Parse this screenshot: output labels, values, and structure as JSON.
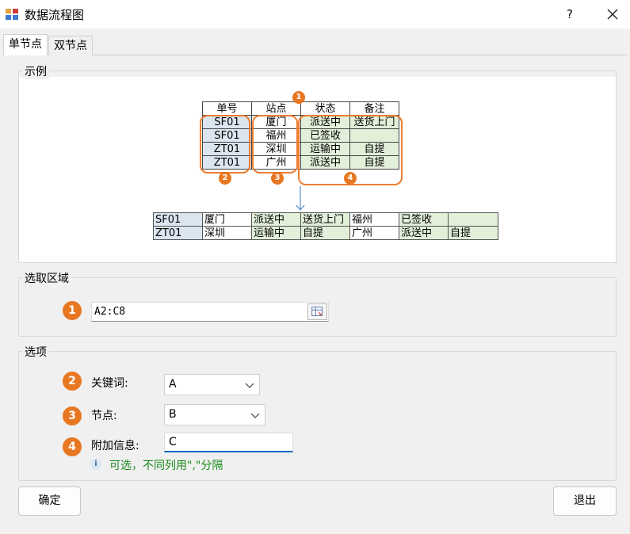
{
  "window": {
    "title": "数据流程图",
    "help_label": "?"
  },
  "tabs": [
    {
      "label": "单节点"
    },
    {
      "label": "双节点"
    }
  ],
  "example": {
    "title": "示例",
    "headers": [
      "单号",
      "站点",
      "状态",
      "备注"
    ],
    "rows": [
      [
        "SF01",
        "厦门",
        "派送中",
        "送货上门"
      ],
      [
        "SF01",
        "福州",
        "已签收",
        ""
      ],
      [
        "ZT01",
        "深圳",
        "运输中",
        "自提"
      ],
      [
        "ZT01",
        "广州",
        "派送中",
        "自提"
      ]
    ],
    "badges": [
      "1",
      "2",
      "3",
      "4"
    ],
    "result_rows": [
      [
        "SF01",
        "厦门",
        "派送中",
        "送货上门",
        "福州",
        "已签收",
        ""
      ],
      [
        "ZT01",
        "深圳",
        "运输中",
        "自提",
        "广州",
        "派送中",
        "自提"
      ]
    ]
  },
  "range_group": {
    "title": "选取区域",
    "badge": "1",
    "value": "A2:C8"
  },
  "options_group": {
    "title": "选项",
    "keyword": {
      "badge": "2",
      "label": "关键词:",
      "value": "A"
    },
    "node": {
      "badge": "3",
      "label": "节点:",
      "value": "B"
    },
    "extra": {
      "badge": "4",
      "label": "附加信息:",
      "value": "C"
    },
    "hint": "可选，不同列用\",\"分隔",
    "hint_icon": "i"
  },
  "buttons": {
    "ok": "确定",
    "exit": "退出"
  },
  "colors": {
    "accent": "#e87722",
    "hint_green": "#1a8a1a",
    "cell_blue": "#dbe5f0",
    "cell_green": "#e2efd9"
  }
}
